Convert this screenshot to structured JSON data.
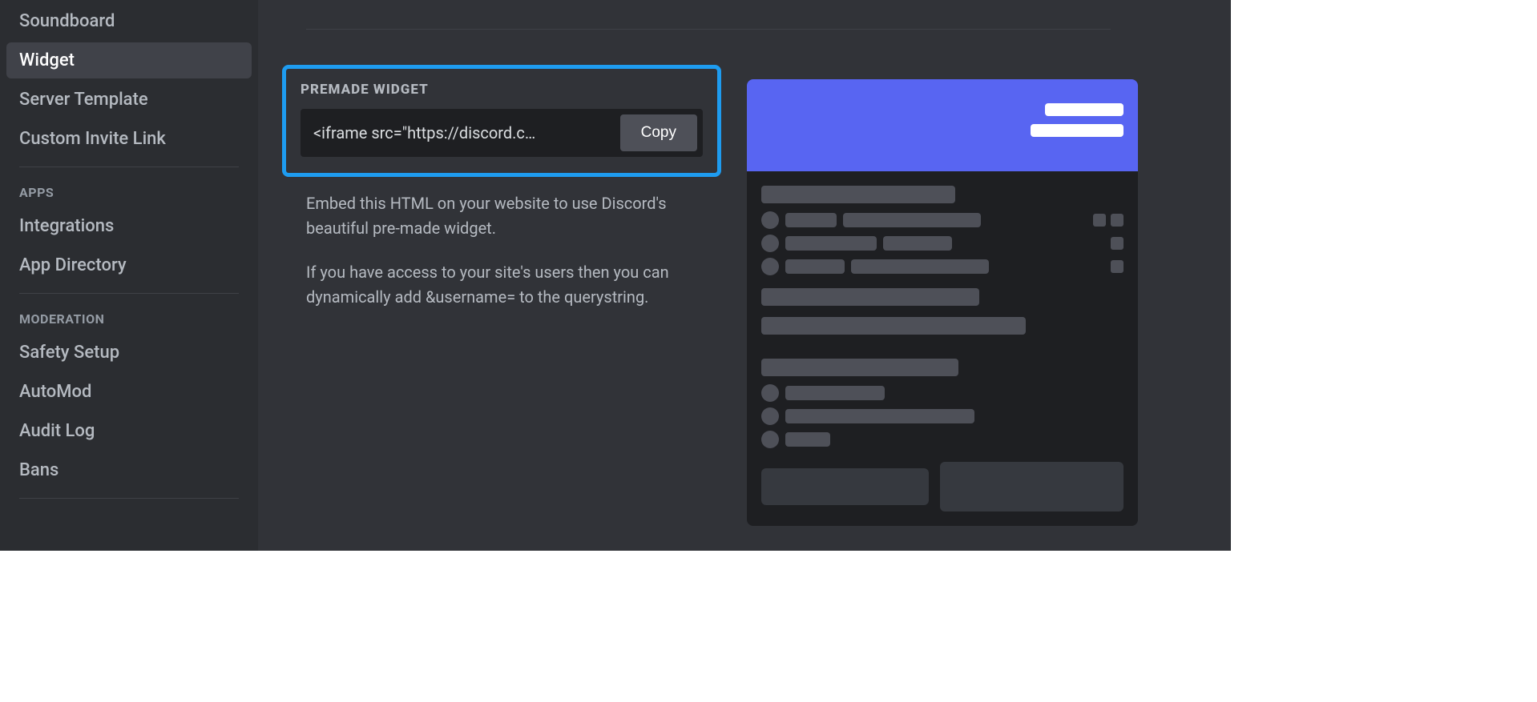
{
  "sidebar": {
    "groups": [
      {
        "heading": null,
        "items": [
          {
            "label": "Soundboard",
            "selected": false,
            "name": "sidebar-item-soundboard"
          },
          {
            "label": "Widget",
            "selected": true,
            "name": "sidebar-item-widget"
          },
          {
            "label": "Server Template",
            "selected": false,
            "name": "sidebar-item-server-template"
          },
          {
            "label": "Custom Invite Link",
            "selected": false,
            "name": "sidebar-item-custom-invite-link"
          }
        ]
      },
      {
        "heading": "APPS",
        "items": [
          {
            "label": "Integrations",
            "selected": false,
            "name": "sidebar-item-integrations"
          },
          {
            "label": "App Directory",
            "selected": false,
            "name": "sidebar-item-app-directory"
          }
        ]
      },
      {
        "heading": "MODERATION",
        "items": [
          {
            "label": "Safety Setup",
            "selected": false,
            "name": "sidebar-item-safety-setup"
          },
          {
            "label": "AutoMod",
            "selected": false,
            "name": "sidebar-item-automod"
          },
          {
            "label": "Audit Log",
            "selected": false,
            "name": "sidebar-item-audit-log"
          },
          {
            "label": "Bans",
            "selected": false,
            "name": "sidebar-item-bans"
          }
        ]
      }
    ]
  },
  "main": {
    "section_label": "Premade Widget",
    "code_value": "<iframe src=\"https://discord.c…",
    "copy_label": "Copy",
    "desc1": "Embed this HTML on your website to use Discord's beautiful pre-made widget.",
    "desc2": "If you have access to your site's users then you can dynamically add &username= to the querystring."
  }
}
